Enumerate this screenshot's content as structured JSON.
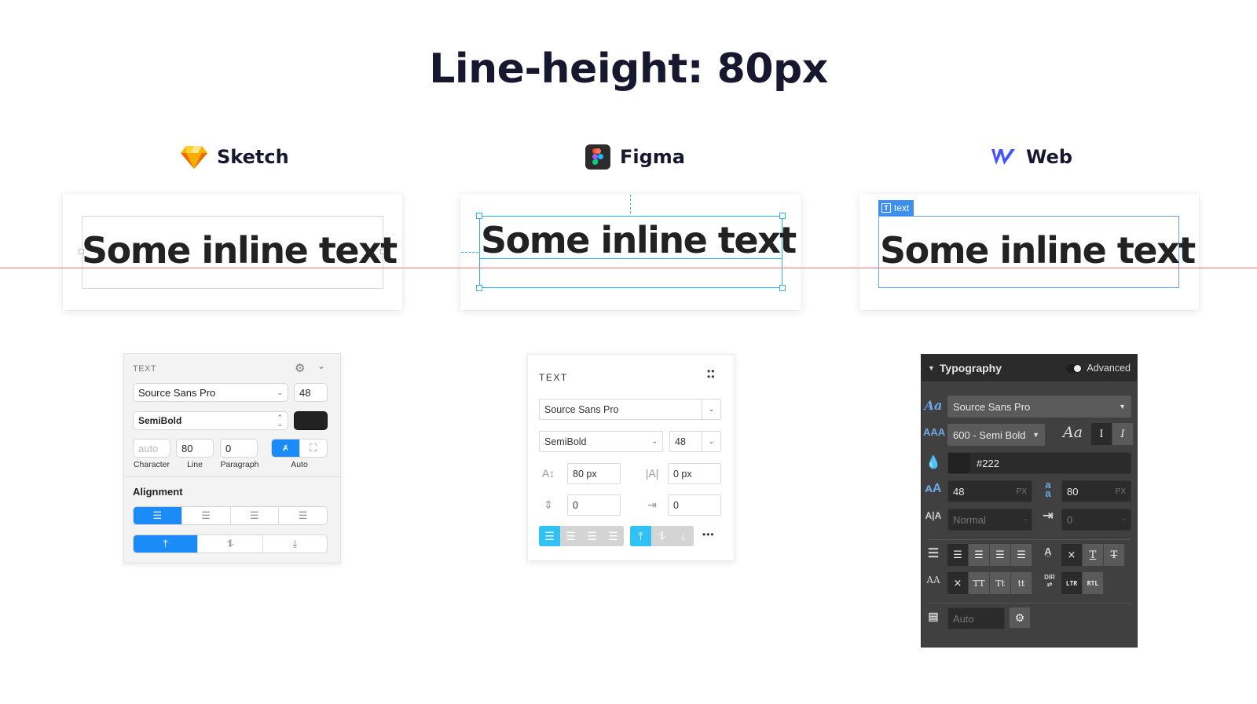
{
  "title": "Line-height: 80px",
  "columns": [
    {
      "name": "Sketch",
      "sample_text": "Some inline text"
    },
    {
      "name": "Figma",
      "sample_text": "Some inline text"
    },
    {
      "name": "Web",
      "sample_text": "Some inline text",
      "tag_label": "text"
    }
  ],
  "sketch_panel": {
    "section": "TEXT",
    "font_family": "Source Sans Pro",
    "font_size": "48",
    "font_weight": "SemiBold",
    "color": "#222222",
    "character_placeholder": "auto",
    "line": "80",
    "paragraph": "0",
    "captions": {
      "character": "Character",
      "line": "Line",
      "paragraph": "Paragraph",
      "auto": "Auto"
    },
    "alignment_label": "Alignment",
    "horizontal_align": [
      "left",
      "center",
      "right",
      "justify"
    ],
    "horizontal_selected": "left",
    "vertical_align": [
      "top",
      "middle",
      "bottom"
    ],
    "vertical_selected": "top"
  },
  "figma_panel": {
    "section": "TEXT",
    "font_family": "Source Sans Pro",
    "font_weight": "SemiBold",
    "font_size": "48",
    "line_height": "80 px",
    "letter_spacing": "0 px",
    "paragraph_spacing": "0",
    "paragraph_indent": "0",
    "horizontal_selected": "left",
    "vertical_selected": "top",
    "more_label": "•••"
  },
  "web_panel": {
    "section": "Typography",
    "advanced_label": "Advanced",
    "font_family": "Source Sans Pro",
    "font_weight": "600 - Semi Bold",
    "color_value": "#222",
    "font_size": "48",
    "font_size_unit": "PX",
    "line_height": "80",
    "line_height_unit": "PX",
    "letter_spacing_placeholder": "Normal",
    "letter_spacing_unit": "-",
    "text_indent_placeholder": "0",
    "text_indent_unit": "-",
    "columns_placeholder": "Auto",
    "italic_label": "Aa",
    "style_buttons": [
      "I",
      "I"
    ],
    "decoration_buttons": [
      "×",
      "T",
      "T"
    ],
    "case_buttons": [
      "×",
      "TT",
      "Tt",
      "tt"
    ],
    "direction_buttons": [
      "LTR",
      "RTL"
    ],
    "case_label": "AA",
    "dir_label": "DIR"
  },
  "colors": {
    "accent_sketch": "#1b8cf7",
    "accent_figma": "#30c2f5",
    "accent_web": "#4a90e2",
    "baseline": "#f07a7a"
  }
}
